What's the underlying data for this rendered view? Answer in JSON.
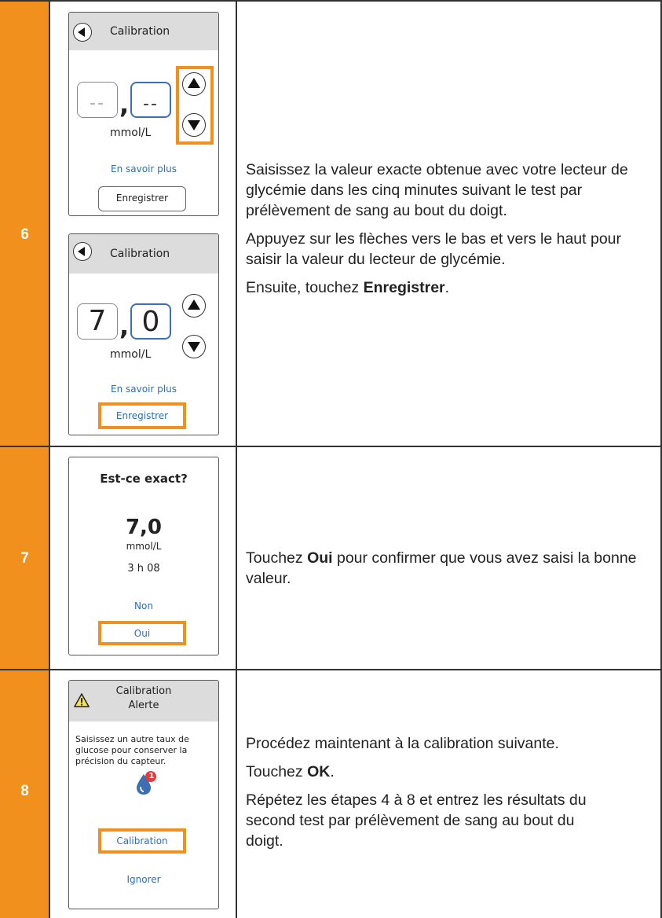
{
  "steps": [
    {
      "number": "6",
      "screens": [
        {
          "title": "Calibration",
          "left_digit": "--",
          "comma": ",",
          "right_digit": "--",
          "unit": "mmol/L",
          "link": "En savoir plus",
          "button": "Enregistrer"
        },
        {
          "title": "Calibration",
          "left_digit": "7",
          "comma": ",",
          "right_digit": "0",
          "unit": "mmol/L",
          "link": "En savoir plus",
          "button": "Enregistrer"
        }
      ],
      "paragraphs": [
        "Saisissez la valeur exacte obtenue avec votre lecteur de glycémie dans les cinq minutes suivant le test par prélèvement de sang au bout du doigt.",
        "Appuyez sur les flèches vers le bas et vers le haut pour saisir la valeur du lecteur de glycémie."
      ],
      "last_prefix": "Ensuite, touchez ",
      "last_bold": "Enregistrer",
      "last_suffix": "."
    },
    {
      "number": "7",
      "screen": {
        "title": "Est-ce exact?",
        "value": "7,0",
        "unit": "mmol/L",
        "time": "3 h 08",
        "link": "Non",
        "button": "Oui"
      },
      "desc_prefix": "Touchez ",
      "desc_bold": "Oui",
      "desc_suffix": " pour confirmer que vous avez saisi la bonne valeur."
    },
    {
      "number": "8",
      "screen": {
        "title_line1": "Calibration",
        "title_line2": "Alerte",
        "message": "Saisissez un autre taux de glucose pour conserver la précision du capteur.",
        "badge": "1",
        "button": "Calibration",
        "link": "Ignorer"
      },
      "para1": "Procédez maintenant à la calibration suivante.",
      "ok_prefix": "Touchez ",
      "ok_bold": "OK",
      "ok_suffix": ".",
      "para3": "Répétez les étapes 4 à 8 et entrez les résultats du second test par prélèvement de sang au bout du doigt."
    }
  ],
  "colors": {
    "accent": "#F2901E",
    "link": "#2f6db5",
    "header_gray": "#dcdcdc"
  }
}
